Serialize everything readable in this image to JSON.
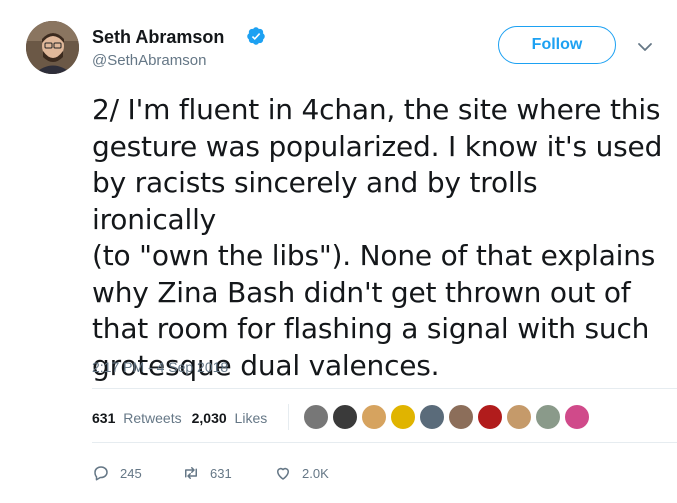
{
  "author": {
    "name": "Seth Abramson",
    "handle": "@SethAbramson",
    "verified": true
  },
  "follow_label": "Follow",
  "tweet_text": "2/ I'm fluent in 4chan, the site where this\ngesture was popularized. I know it's used\nby racists sincerely and by trolls ironically\n(to \"own the libs\"). None of that explains\nwhy Zina Bash didn't get thrown out of\nthat room for flashing a signal with such\ngrotesque dual valences.",
  "timestamp": "2:17 PM - 4 Sep 2018",
  "stats": {
    "retweets_count": "631",
    "retweets_label": "Retweets",
    "likes_count": "2,030",
    "likes_label": "Likes"
  },
  "actions": {
    "reply_count": "245",
    "retweet_count": "631",
    "like_count": "2.0K"
  },
  "colors": {
    "accent": "#1da1f2",
    "secondary_text": "#657786"
  },
  "icons": [
    "verified-badge-icon",
    "chevron-down-icon",
    "reply-icon",
    "retweet-icon",
    "heart-icon"
  ]
}
